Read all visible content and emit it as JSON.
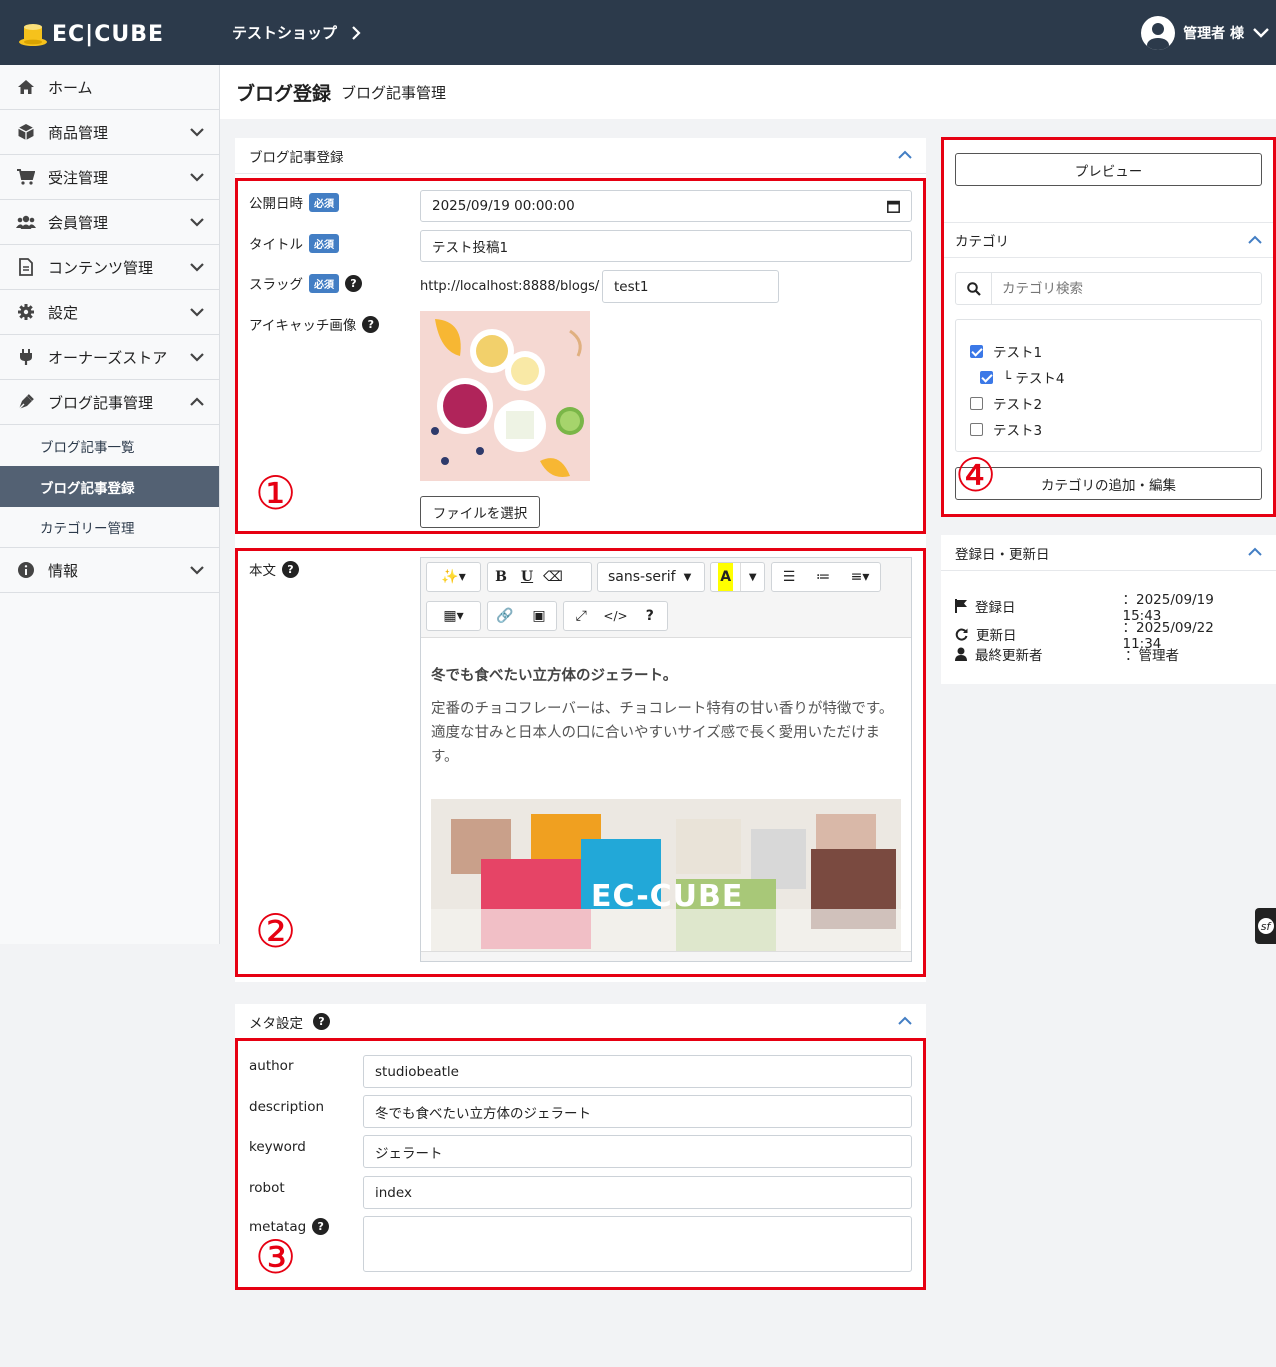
{
  "header": {
    "logo_text": "EC|CUBE",
    "shop_name": "テストショップ",
    "user_label": "管理者 様"
  },
  "sidebar": {
    "items": [
      {
        "label": "ホーム",
        "icon": "home-icon"
      },
      {
        "label": "商品管理",
        "icon": "cube-icon"
      },
      {
        "label": "受注管理",
        "icon": "cart-icon"
      },
      {
        "label": "会員管理",
        "icon": "users-icon"
      },
      {
        "label": "コンテンツ管理",
        "icon": "file-icon"
      },
      {
        "label": "設定",
        "icon": "gear-icon"
      },
      {
        "label": "オーナーズストア",
        "icon": "plug-icon"
      },
      {
        "label": "ブログ記事管理",
        "icon": "pen-icon"
      },
      {
        "label": "情報",
        "icon": "info-icon"
      }
    ],
    "blog_sub": [
      "ブログ記事一覧",
      "ブログ記事登録",
      "カテゴリー管理"
    ],
    "active_sub": "ブログ記事登録"
  },
  "page": {
    "title": "ブログ登録",
    "subtitle": "ブログ記事管理"
  },
  "form": {
    "card_title": "ブログ記事登録",
    "required_badge": "必須",
    "publish_label": "公開日時",
    "publish_value": "2025/09/19 00:00:00",
    "title_label": "タイトル",
    "title_value": "テスト投稿1",
    "slug_label": "スラッグ",
    "slug_prefix": "http://localhost:8888/blogs/",
    "slug_value": "test1",
    "eyecatch_label": "アイキャッチ画像",
    "file_button": "ファイルを選択",
    "body_label": "本文",
    "font_name": "sans-serif",
    "body_heading": "冬でも食べたい立方体のジェラート。",
    "body_text": "定番のチョコフレーバーは、チョコレート特有の甘い香りが特徴です。適度な甘みと日本人の口に合いやすいサイズ感で長く愛用いただけます。",
    "body_image_text": "EC-CUBE"
  },
  "meta": {
    "card_title": "メタ設定",
    "author_label": "author",
    "author_value": "studiobeatle",
    "description_label": "description",
    "description_value": "冬でも食べたい立方体のジェラート",
    "keyword_label": "keyword",
    "keyword_value": "ジェラート",
    "robot_label": "robot",
    "robot_value": "index",
    "metatag_label": "metatag",
    "metatag_value": ""
  },
  "right": {
    "preview_button": "プレビュー",
    "category_title": "カテゴリ",
    "category_search_placeholder": "カテゴリ検索",
    "categories": [
      {
        "label": "テスト1",
        "checked": true
      },
      {
        "label": "└ テスト4",
        "checked": true
      },
      {
        "label": "テスト2",
        "checked": false
      },
      {
        "label": "テスト3",
        "checked": false
      }
    ],
    "category_edit_button": "カテゴリの追加・編集",
    "dates_title": "登録日・更新日",
    "created_label": "登録日",
    "created_value": "：2025/09/19 15:43",
    "updated_label": "更新日",
    "updated_value": "：2025/09/22 11:34",
    "updater_label": "最終更新者",
    "updater_value": "：管理者"
  },
  "annotations": [
    "①",
    "②",
    "③",
    "④"
  ],
  "colors": {
    "header_bg": "#2c3a4b",
    "active_sub": "#536173",
    "badge": "#437ec4",
    "annotation_red": "#e60012"
  }
}
